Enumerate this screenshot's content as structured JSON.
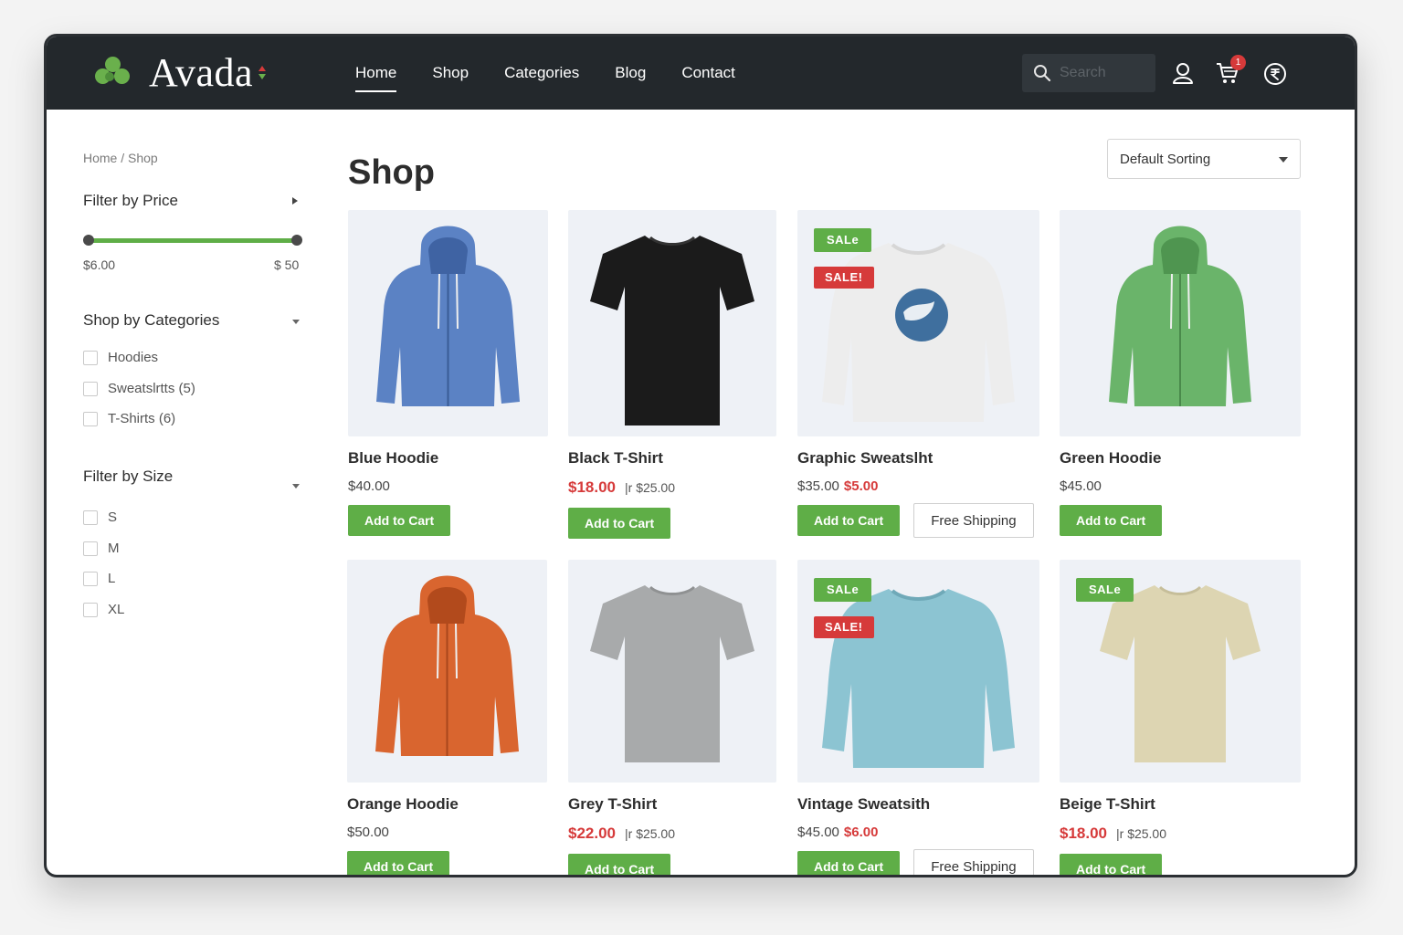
{
  "brand": {
    "name": "Avada",
    "accent_green": "#6ab04c",
    "accent_red": "#d63a3a"
  },
  "nav": [
    {
      "label": "Home",
      "active": true
    },
    {
      "label": "Shop"
    },
    {
      "label": "Categories"
    },
    {
      "label": "Blog"
    },
    {
      "label": "Contact"
    }
  ],
  "header": {
    "search_placeholder": "Search",
    "cart_count": "1",
    "icons": [
      "search-icon",
      "user-icon",
      "cart-icon",
      "currency-icon"
    ]
  },
  "sidebar": {
    "breadcrumb": "Home / Shop",
    "price_filter": {
      "title": "Filter by Price",
      "min_label": "$6.00",
      "max_label": "$ 50"
    },
    "categories": {
      "title": "Shop by Categories",
      "items": [
        "Hoodies",
        "Sweatslrtts (5)",
        "T-Shirts (6)"
      ]
    },
    "sizes": {
      "title": "Filter by Size",
      "items": [
        "S",
        "M",
        "L",
        "XL"
      ]
    }
  },
  "main": {
    "title": "Shop",
    "sort": "Default Sorting",
    "products": [
      {
        "name": "Blue Hoodie",
        "price": "$40.00",
        "button": "Add to Cart",
        "kind": "hoodie",
        "color": "#5b82c4"
      },
      {
        "name": "Black T-Shirt",
        "sale_price": "$18.00",
        "old_price": "|r $25.00",
        "button": "Add to Cart",
        "kind": "tshirt",
        "color": "#1b1b1b"
      },
      {
        "name": "Graphic Sweatslht",
        "price": "$35.00",
        "new_price": "$5.00",
        "badges": [
          "SALe",
          "SALE!"
        ],
        "button": "Add to Cart",
        "secondary": "Free Shipping",
        "kind": "sweatshirt-graphic",
        "color": "#ededed"
      },
      {
        "name": "Green Hoodie",
        "price": "$45.00",
        "button": "Add to Cart",
        "kind": "hoodie",
        "color": "#6ab46a"
      },
      {
        "name": "Orange Hoodie",
        "price": "$50.00",
        "button": "Add to Cart",
        "kind": "hoodie",
        "color": "#d9652f"
      },
      {
        "name": "Grey T-Shirt",
        "sale_price": "$22.00",
        "old_price": "|r $25.00",
        "button": "Add to Cart",
        "kind": "tshirt",
        "color": "#a8aaab"
      },
      {
        "name": "Vintage Sweatsith",
        "price": "$45.00",
        "new_price": "$6.00",
        "badges": [
          "SALe",
          "SALE!"
        ],
        "button": "Add to Cart",
        "secondary": "Free Shipping",
        "kind": "sweatshirt",
        "color": "#8cc4d2"
      },
      {
        "name": "Beige T-Shirt",
        "sale_price": "$18.00",
        "old_price": "|r $25.00",
        "badges": [
          "SALe"
        ],
        "button": "Add to Cart",
        "kind": "tshirt",
        "color": "#ddd5b2"
      }
    ]
  }
}
